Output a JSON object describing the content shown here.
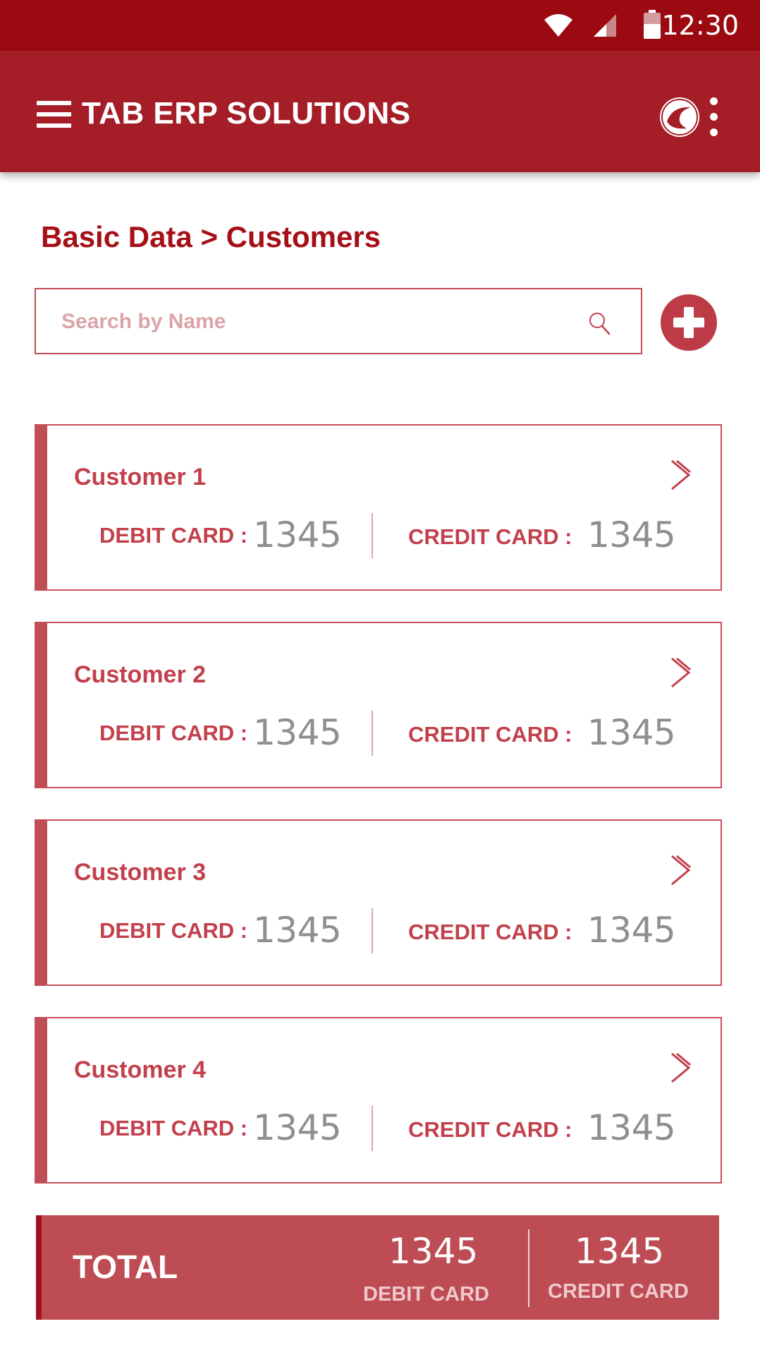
{
  "status_bar": {
    "time": "12:30"
  },
  "app_bar": {
    "title": "TAB ERP SOLUTIONS"
  },
  "breadcrumb": "Basic Data > Customers",
  "search": {
    "placeholder": "Search by Name",
    "value": ""
  },
  "customers": [
    {
      "name": "Customer 1",
      "debit_label": "DEBIT CARD :",
      "debit_value": "1345",
      "credit_label": "CREDIT CARD :",
      "credit_value": "1345"
    },
    {
      "name": "Customer 2",
      "debit_label": "DEBIT CARD :",
      "debit_value": "1345",
      "credit_label": "CREDIT CARD :",
      "credit_value": "1345"
    },
    {
      "name": "Customer 3",
      "debit_label": "DEBIT CARD :",
      "debit_value": "1345",
      "credit_label": "CREDIT CARD :",
      "credit_value": "1345"
    },
    {
      "name": "Customer 4",
      "debit_label": "DEBIT CARD :",
      "debit_value": "1345",
      "credit_label": "CREDIT CARD :",
      "credit_value": "1345"
    }
  ],
  "total": {
    "label": "TOTAL",
    "debit_value": "1345",
    "debit_label": "DEBIT CARD",
    "credit_value": "1345",
    "credit_label": "CREDIT CARD"
  },
  "colors": {
    "status_bar": "#9c0a11",
    "app_bar": "#a51e27",
    "accent": "#c2404c",
    "total_bar": "#bd4c54"
  },
  "icons": [
    "wifi-icon",
    "signal-icon",
    "battery-icon",
    "menu-icon",
    "app-logo-icon",
    "more-vert-icon",
    "search-icon",
    "add-circle-icon",
    "chevron-right-icon"
  ]
}
